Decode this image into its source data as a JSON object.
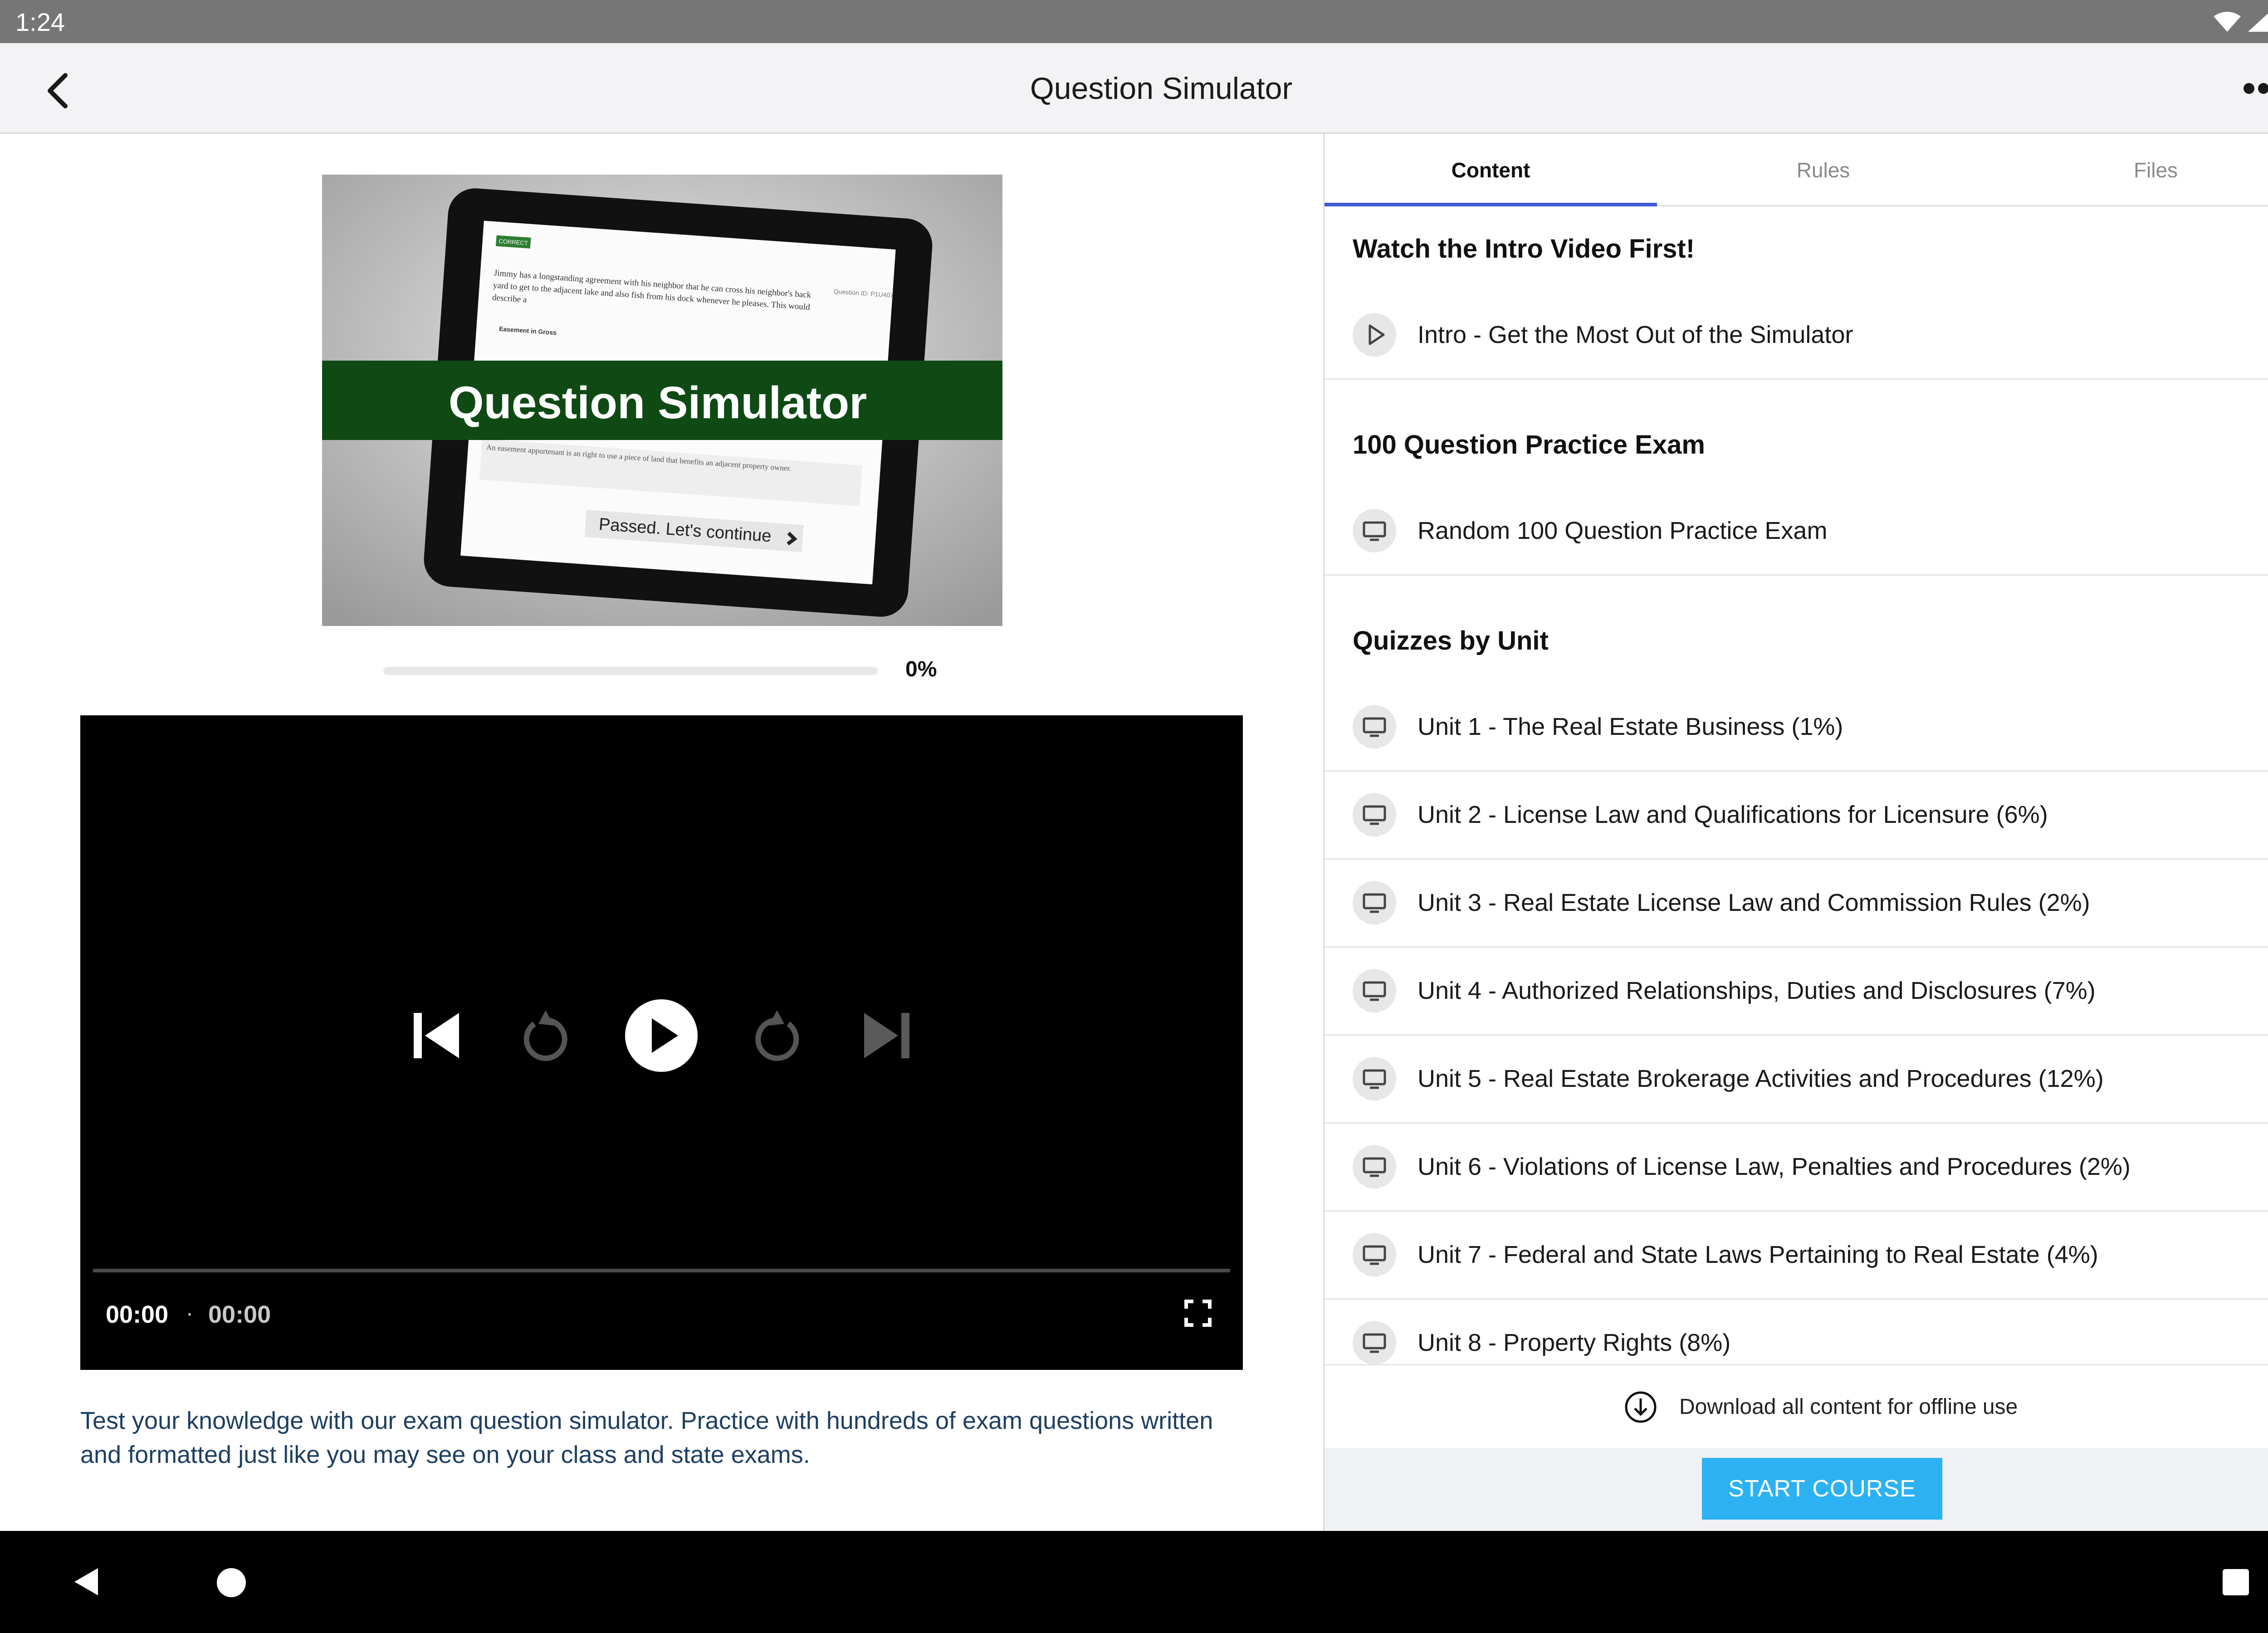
{
  "status_bar": {
    "time": "1:24"
  },
  "app_bar": {
    "title": "Question Simulator"
  },
  "thumbnail": {
    "banner_text": "Question Simulator",
    "correct_tag": "CORRECT",
    "question_text": "Jimmy has a longstanding agreement with his neighbor that he can cross his neighbor's back yard to get to the adjacent lake and also fish from his dock whenever he pleases. This would describe a",
    "question_id": "Question ID: P1U407",
    "answer_text": "Easement in Gross",
    "explanation_text": "An easement appurtenant is an right to use a piece of land that benefits an adjacent property owner.",
    "button_text": "Passed. Let's continue"
  },
  "progress": {
    "value": 0,
    "label": "0%"
  },
  "video": {
    "current_time": "00:00",
    "separator": "·",
    "total_time": "00:00"
  },
  "description": "Test your knowledge with our exam question simulator. Practice with hundreds of exam questions written and formatted just like you may see on your class and state exams.",
  "tabs": [
    {
      "label": "Content",
      "active": true
    },
    {
      "label": "Rules",
      "active": false
    },
    {
      "label": "Files",
      "active": false
    }
  ],
  "sections": [
    {
      "title": "Watch the Intro Video First!",
      "items": [
        {
          "label": "Intro - Get the Most Out of the Simulator",
          "icon": "play-icon"
        }
      ]
    },
    {
      "title": "100 Question Practice Exam",
      "items": [
        {
          "label": "Random 100 Question Practice Exam",
          "icon": "monitor-icon"
        }
      ]
    },
    {
      "title": "Quizzes by Unit",
      "items": [
        {
          "label": "Unit 1 - The Real Estate Business (1%)",
          "icon": "monitor-icon"
        },
        {
          "label": "Unit 2 - License Law and Qualifications for Licensure (6%)",
          "icon": "monitor-icon"
        },
        {
          "label": "Unit 3 - Real Estate License Law and Commission Rules (2%)",
          "icon": "monitor-icon"
        },
        {
          "label": "Unit 4 - Authorized Relationships, Duties and Disclosures (7%)",
          "icon": "monitor-icon"
        },
        {
          "label": "Unit 5 - Real Estate Brokerage Activities and Procedures (12%)",
          "icon": "monitor-icon"
        },
        {
          "label": "Unit 6 - Violations of License Law, Penalties and Procedures (2%)",
          "icon": "monitor-icon"
        },
        {
          "label": "Unit 7 - Federal and State Laws Pertaining to Real Estate (4%)",
          "icon": "monitor-icon"
        },
        {
          "label": "Unit 8 - Property Rights (8%)",
          "icon": "monitor-icon"
        }
      ]
    }
  ],
  "download": {
    "label": "Download all content for offline use",
    "icon": "download-circle-icon"
  },
  "footer": {
    "start_button": "START COURSE"
  },
  "colors": {
    "accent": "#3f5bd1",
    "start_button": "#2cb2f2",
    "description_text": "#1e3f63",
    "banner": "#0f4a14"
  }
}
